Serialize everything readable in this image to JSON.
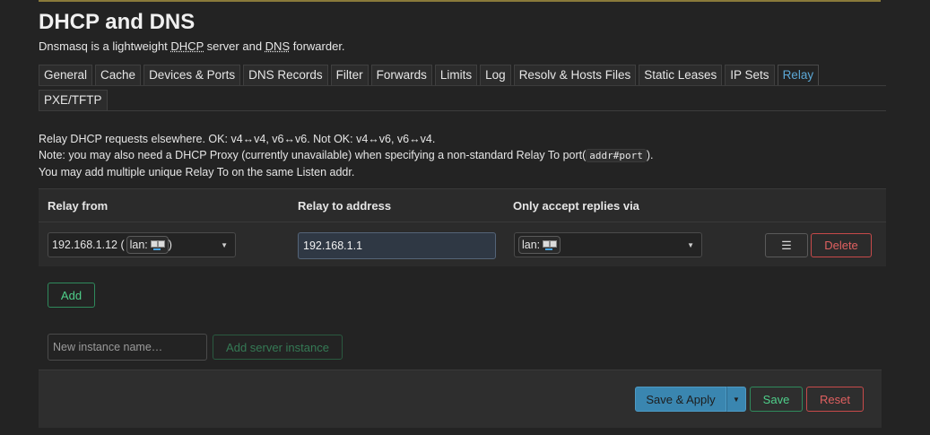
{
  "page": {
    "title": "DHCP and DNS",
    "desc_pre": "Dnsmasq is a lightweight ",
    "desc_dhcp": "DHCP",
    "desc_mid": " server and ",
    "desc_dns": "DNS",
    "desc_post": " forwarder."
  },
  "tabs": [
    "General",
    "Cache",
    "Devices & Ports",
    "DNS Records",
    "Filter",
    "Forwards",
    "Limits",
    "Log",
    "Resolv & Hosts Files",
    "Static Leases",
    "IP Sets",
    "Relay",
    "PXE/TFTP"
  ],
  "info": {
    "line1": "Relay DHCP requests elsewhere. OK: v4↔v4, v6↔v6. Not OK: v4↔v6, v6↔v4.",
    "line2_pre": "Note: you may also need a DHCP Proxy (currently unavailable) when specifying a non-standard Relay To port(",
    "line2_code": "addr#port",
    "line2_post": ").",
    "line3": "You may add multiple unique Relay To on the same Listen addr."
  },
  "table": {
    "headers": [
      "Relay from",
      "Relay to address",
      "Only accept replies via"
    ],
    "row": {
      "relay_from_ip": "192.168.1.12 (",
      "relay_from_iface": "lan:",
      "relay_from_close": ")",
      "relay_to": "192.168.1.1",
      "replies_iface": "lan:",
      "delete_label": "Delete"
    }
  },
  "buttons": {
    "add": "Add",
    "new_instance_placeholder": "New instance name…",
    "add_server_instance": "Add server instance",
    "save_apply": "Save & Apply",
    "save": "Save",
    "reset": "Reset"
  },
  "colors": {
    "accent": "#5ca8d6",
    "positive": "#4fcf8a",
    "negative": "#e06060"
  }
}
